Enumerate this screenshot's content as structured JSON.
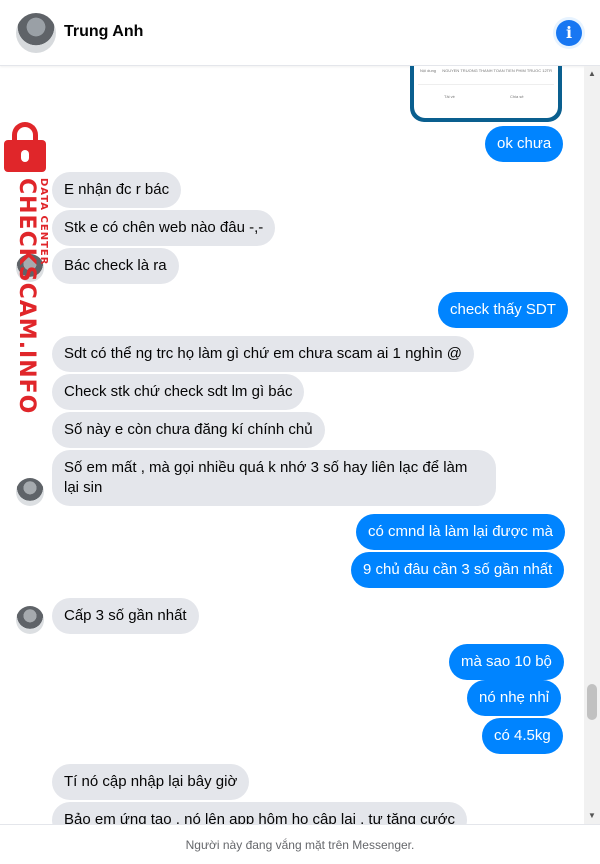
{
  "header": {
    "name": "Trung Anh",
    "info_icon": "info-icon"
  },
  "attachment": {
    "left_label": "Nội dung",
    "right_label": "NGUYEN TRUONG THANH TOAN TIEN PHIM TRUOC 12TR",
    "download": "Tải về",
    "share": "Chia sẻ"
  },
  "watermark": {
    "brand": "CHECKSCAM.INFO",
    "sub": "DATA CENTER",
    "icon": "lock-icon",
    "color": "#e0262a"
  },
  "messages": [
    {
      "side": "out",
      "text": "ok chưa"
    },
    {
      "side": "in",
      "text": "E nhận đc r bác"
    },
    {
      "side": "in",
      "text": "Stk e có chên web nào đâu -,-"
    },
    {
      "side": "in",
      "text": "Bác check là ra"
    },
    {
      "side": "out",
      "text": "check thấy SDT"
    },
    {
      "side": "in",
      "text": "Sdt có thể ng trc họ làm gì chứ em chưa scam ai 1 nghìn @"
    },
    {
      "side": "in",
      "text": "Check stk chứ check sdt lm gì bác"
    },
    {
      "side": "in",
      "text": "Số này e còn chưa đăng kí chính chủ"
    },
    {
      "side": "in",
      "text": "Số em mất , mà gọi nhiều quá k nhớ 3 số hay liên lạc để làm lại sin"
    },
    {
      "side": "out",
      "text": "có cmnd là làm lại được mà"
    },
    {
      "side": "out",
      "text": "9 chủ đâu cần 3 số gần nhất"
    },
    {
      "side": "in",
      "text": "Cấp 3 số gần nhất"
    },
    {
      "side": "out",
      "text": "mà sao 10 bộ"
    },
    {
      "side": "out",
      "text": "nó nhẹ nhỉ"
    },
    {
      "side": "out",
      "text": "có 4.5kg"
    },
    {
      "side": "in",
      "text": "Tí nó cập nhập lại bây giờ"
    },
    {
      "side": "in",
      "text": "Bảo em ứng tạo , nó lên app hôm họ cập lại , tự tăng cước"
    }
  ],
  "footer": {
    "text": "Người này đang vắng mặt trên Messenger."
  },
  "colors": {
    "outgoing": "#0084ff",
    "incoming": "#e4e6eb",
    "accent": "#1877f2"
  }
}
